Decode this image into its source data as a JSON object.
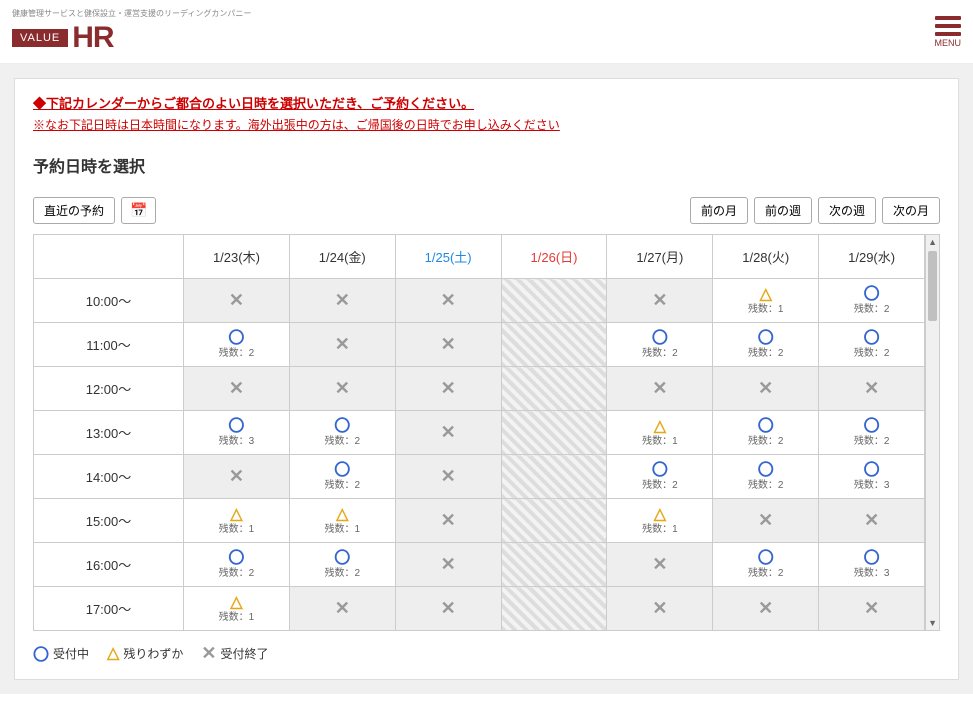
{
  "header": {
    "tagline": "健康管理サービスと健保設立・運営支援のリーディングカンパニー",
    "logo_value": "VALUE",
    "logo_hr": "HR",
    "menu_label": "MENU"
  },
  "notices": {
    "line1": "◆下記カレンダーからご都合のよい日時を選択いただき、ご予約ください。",
    "line2": "※なお下記日時は日本時間になります。海外出張中の方は、ご帰国後の日時でお申し込みください"
  },
  "page_title": "予約日時を選択",
  "toolbar": {
    "recent": "直近の予約",
    "prev_month": "前の月",
    "prev_week": "前の週",
    "next_week": "次の週",
    "next_month": "次の月"
  },
  "dates": [
    {
      "label": "1/23(木)",
      "cls": ""
    },
    {
      "label": "1/24(金)",
      "cls": ""
    },
    {
      "label": "1/25(土)",
      "cls": "saturday"
    },
    {
      "label": "1/26(日)",
      "cls": "sunday"
    },
    {
      "label": "1/27(月)",
      "cls": ""
    },
    {
      "label": "1/28(火)",
      "cls": ""
    },
    {
      "label": "1/29(水)",
      "cls": ""
    }
  ],
  "times": [
    "10:00～",
    "11:00～",
    "12:00～",
    "13:00～",
    "14:00～",
    "15:00～",
    "16:00～",
    "17:00～"
  ],
  "grid": [
    [
      {
        "t": "x"
      },
      {
        "t": "x"
      },
      {
        "t": "x"
      },
      {
        "t": "h"
      },
      {
        "t": "x"
      },
      {
        "t": "tri",
        "n": 1
      },
      {
        "t": "o",
        "n": 2
      }
    ],
    [
      {
        "t": "o",
        "n": 2
      },
      {
        "t": "x"
      },
      {
        "t": "x"
      },
      {
        "t": "h"
      },
      {
        "t": "o",
        "n": 2
      },
      {
        "t": "o",
        "n": 2
      },
      {
        "t": "o",
        "n": 2
      }
    ],
    [
      {
        "t": "x"
      },
      {
        "t": "x"
      },
      {
        "t": "x"
      },
      {
        "t": "h"
      },
      {
        "t": "x"
      },
      {
        "t": "x"
      },
      {
        "t": "x"
      }
    ],
    [
      {
        "t": "o",
        "n": 3
      },
      {
        "t": "o",
        "n": 2
      },
      {
        "t": "x"
      },
      {
        "t": "h"
      },
      {
        "t": "tri",
        "n": 1
      },
      {
        "t": "o",
        "n": 2
      },
      {
        "t": "o",
        "n": 2
      }
    ],
    [
      {
        "t": "x"
      },
      {
        "t": "o",
        "n": 2
      },
      {
        "t": "x"
      },
      {
        "t": "h"
      },
      {
        "t": "o",
        "n": 2
      },
      {
        "t": "o",
        "n": 2
      },
      {
        "t": "o",
        "n": 3
      }
    ],
    [
      {
        "t": "tri",
        "n": 1
      },
      {
        "t": "tri",
        "n": 1
      },
      {
        "t": "x"
      },
      {
        "t": "h"
      },
      {
        "t": "tri",
        "n": 1
      },
      {
        "t": "x"
      },
      {
        "t": "x"
      }
    ],
    [
      {
        "t": "o",
        "n": 2
      },
      {
        "t": "o",
        "n": 2
      },
      {
        "t": "x"
      },
      {
        "t": "h"
      },
      {
        "t": "x"
      },
      {
        "t": "o",
        "n": 2
      },
      {
        "t": "o",
        "n": 3
      }
    ],
    [
      {
        "t": "tri",
        "n": 1
      },
      {
        "t": "x"
      },
      {
        "t": "x"
      },
      {
        "t": "h"
      },
      {
        "t": "x"
      },
      {
        "t": "x"
      },
      {
        "t": "x"
      }
    ]
  ],
  "count_prefix": "残数：",
  "legend": {
    "accepting": "受付中",
    "few": "残りわずか",
    "closed": "受付終了"
  }
}
